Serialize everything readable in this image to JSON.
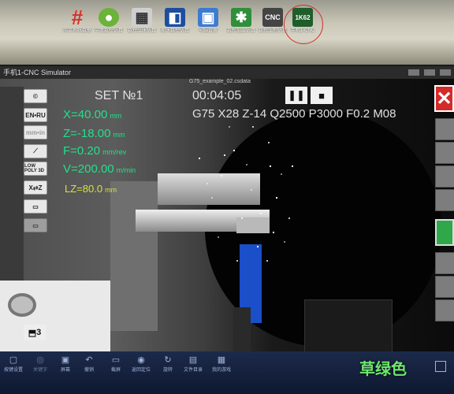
{
  "desktop": {
    "icons": [
      {
        "glyph": "#",
        "label": "简单系统数据",
        "color": "#d9302a"
      },
      {
        "glyph": "●",
        "label": "宇龙数控仿真",
        "color": "#6bb33a"
      },
      {
        "glyph": "▦",
        "label": "数控车床仿真",
        "color": "#cfcfcf"
      },
      {
        "glyph": "◧",
        "label": "斯沃数控仿真",
        "color": "#1d4e9e"
      },
      {
        "glyph": "▣",
        "label": "电脑管家",
        "color": "#3d7bd1"
      },
      {
        "glyph": "✱",
        "label": "数控加工仿真",
        "color": "#2f8f3a"
      },
      {
        "glyph": "CNC",
        "label": "数控车削仿真",
        "color": "#444444"
      },
      {
        "glyph": "1K62",
        "label": "手机1-CNC",
        "color": "#1f5d2a"
      }
    ]
  },
  "window": {
    "title": "手机1-CNC Simulator",
    "file": "G75_example_02.csdata"
  },
  "toolbar_left": {
    "copyright": "©",
    "lang": "EN•RU",
    "units": "mm•in",
    "lowpoly": "LOW POLY 3D",
    "xz": "X⇄Z",
    "turret": "3"
  },
  "readouts": {
    "x": {
      "value": "X=40.00",
      "unit": "mm"
    },
    "z": {
      "value": "Z=-18.00",
      "unit": "mm"
    },
    "f": {
      "value": "F=0.20",
      "unit": "mm/rev"
    },
    "v": {
      "value": "V=200.00",
      "unit": "m/min"
    },
    "lz": {
      "value": "LZ=80.0",
      "unit": "mm"
    }
  },
  "program": {
    "set": "SET №1",
    "time": "00:04:05",
    "gcode": "G75 X28 Z-14 Q2500 P3000 F0.2 M08",
    "pause_icon": "pause-icon",
    "stop_icon": "stop-icon",
    "close": "✕"
  },
  "taskbar": {
    "items": [
      {
        "icon": "▢",
        "label": "按键设置"
      },
      {
        "icon": "◎",
        "label": "关键字"
      },
      {
        "icon": "▣",
        "label": "屏幕"
      },
      {
        "icon": "↶",
        "label": "撤销"
      },
      {
        "icon": "▭",
        "label": "截屏"
      },
      {
        "icon": "◉",
        "label": "返回定位"
      },
      {
        "icon": "↻",
        "label": "旋转"
      },
      {
        "icon": "▤",
        "label": "文件目录"
      },
      {
        "icon": "▦",
        "label": "我的游戏"
      }
    ]
  },
  "caption": "草绿色",
  "colors": {
    "readout": "#21e08c",
    "lz": "#d8e23a",
    "close": "#d42a2a",
    "caption": "#6ee86e"
  }
}
